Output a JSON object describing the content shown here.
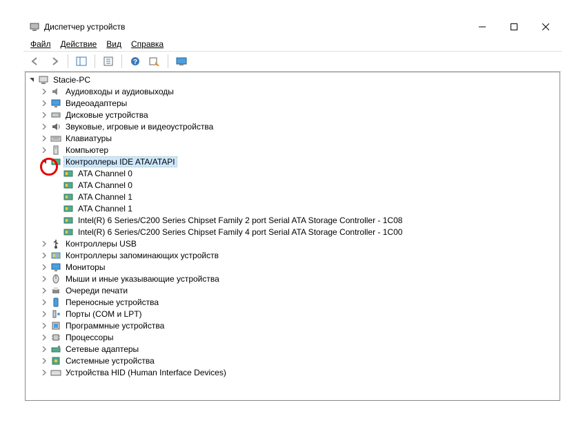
{
  "titlebar": {
    "title": "Диспетчер устройств"
  },
  "menu": {
    "file": "Файл",
    "action": "Действие",
    "view": "Вид",
    "help": "Справка"
  },
  "tree": {
    "root": "Stacie-PC",
    "categories": [
      "Аудиовходы и аудиовыходы",
      "Видеоадаптеры",
      "Дисковые устройства",
      "Звуковые, игровые и видеоустройства",
      "Клавиатуры",
      "Компьютер",
      "Контроллеры IDE ATA/ATAPI",
      "Контроллеры USB",
      "Контроллеры запоминающих устройств",
      "Мониторы",
      "Мыши и иные указывающие устройства",
      "Очереди печати",
      "Переносные устройства",
      "Порты (COM и LPT)",
      "Программные устройства",
      "Процессоры",
      "Сетевые адаптеры",
      "Системные устройства",
      "Устройства HID (Human Interface Devices)"
    ],
    "ide_children": [
      "ATA Channel 0",
      "ATA Channel 0",
      "ATA Channel 1",
      "ATA Channel 1",
      "Intel(R) 6 Series/C200 Series Chipset Family 2 port Serial ATA Storage Controller - 1C08",
      "Intel(R) 6 Series/C200 Series Chipset Family 4 port Serial ATA Storage Controller - 1C00"
    ]
  }
}
